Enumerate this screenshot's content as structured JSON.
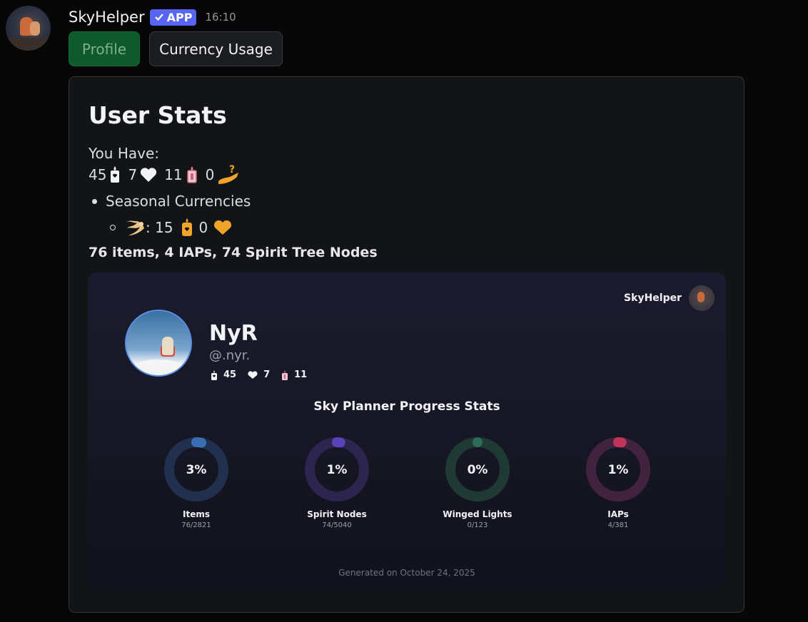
{
  "message": {
    "username": "SkyHelper",
    "badge": "APP",
    "timestamp": "16:10"
  },
  "buttons": {
    "profile": "Profile",
    "currency_usage": "Currency Usage"
  },
  "card": {
    "title": "User Stats",
    "you_have": "You Have:",
    "currencies": [
      {
        "value": "45",
        "icon": "candle-icon"
      },
      {
        "value": "7",
        "icon": "heart-icon"
      },
      {
        "value": "11",
        "icon": "ascended-candle-icon"
      },
      {
        "value": "0",
        "icon": "gift-hand-icon"
      }
    ],
    "seasonal_label": "Seasonal Currencies",
    "seasonal_value": ": 15",
    "seasonal_zero": "0",
    "summary": "76 items, 4 IAPs, 74 Spirit Tree Nodes"
  },
  "panel": {
    "brand": "SkyHelper",
    "name": "NyR",
    "handle": "@.nyr.",
    "mini_currencies": [
      "45",
      "7",
      "11"
    ],
    "stats_title": "Sky Planner Progress Stats",
    "gauges": [
      {
        "percent": "3%",
        "fraction": 0.03,
        "label": "Items",
        "sub": "76/2821",
        "track": "#22304f",
        "fill": "#3b6db3"
      },
      {
        "percent": "1%",
        "fraction": 0.01,
        "label": "Spirit Nodes",
        "sub": "74/5040",
        "track": "#2c2550",
        "fill": "#5a43b8"
      },
      {
        "percent": "0%",
        "fraction": 0.0,
        "label": "Winged Lights",
        "sub": "0/123",
        "track": "#1f3a33",
        "fill": "#2d6a57"
      },
      {
        "percent": "1%",
        "fraction": 0.01,
        "label": "IAPs",
        "sub": "4/381",
        "track": "#41233f",
        "fill": "#c2335a"
      }
    ],
    "generated": "Generated on October 24, 2025"
  }
}
